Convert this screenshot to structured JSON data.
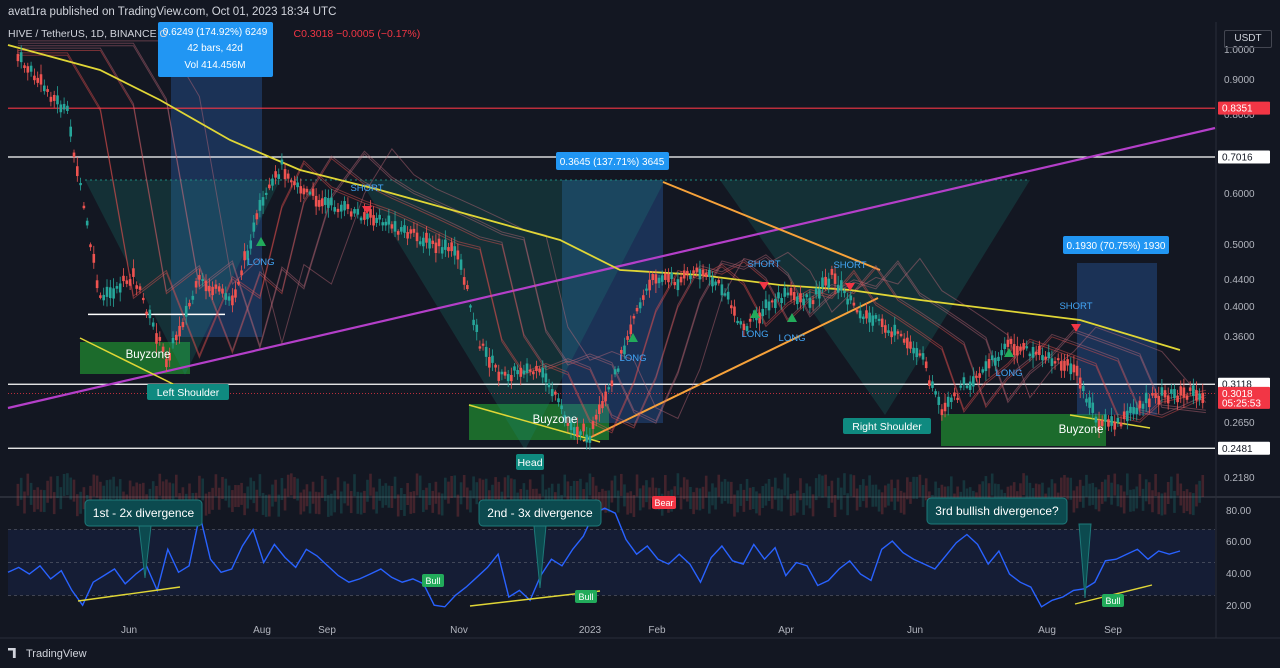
{
  "header": {
    "published_text": "avat1ra published on TradingView.com, Oct 01, 2023 18:34 UTC",
    "symbol_line": "HIVE / TetherUS, 1D, BINANCE",
    "ohlc_partial": "O",
    "last_close": "C0.3018",
    "change": "−0.0005 (−0.17%)",
    "currency_button": "USDT"
  },
  "footer": {
    "brand": "TradingView"
  },
  "colors": {
    "background": "#131722",
    "bull_candle": "#26a69a",
    "bear_candle": "#ef5350",
    "ma_yellow": "#e0d636",
    "trend_purple": "#b43fc9",
    "trend_orange": "#f7a23a",
    "rsi_line": "#2962ff",
    "red_level": "#f23645",
    "buyzone": "#1f7a2e",
    "measure_blue": "#2a63b6",
    "pattern_teal": "#1d8c80",
    "label_teal": "#0f8a80",
    "bull_label": "#22ab5b",
    "bear_label": "#f23645"
  },
  "chart_data": [
    {
      "type": "line",
      "name": "HIVE/USDT 1D price",
      "x_tick_labels": [
        "Jun",
        "Aug",
        "Sep",
        "Nov",
        "2023",
        "Feb",
        "Apr",
        "Jun",
        "Aug",
        "Sep"
      ],
      "y_scale": "log",
      "y_tick_labels": [
        "1.0000",
        "0.9000",
        "0.8000",
        "0.6000",
        "0.5000",
        "0.4400",
        "0.4000",
        "0.3600",
        "0.2650",
        "0.2480",
        "0.2180"
      ],
      "ylim": [
        0.21,
        1.05
      ],
      "price_tags": [
        {
          "label": "0.8351",
          "value": 0.8351,
          "color": "#f23645"
        },
        {
          "label": "0.7016",
          "value": 0.7016,
          "color": "#ffffff"
        },
        {
          "label": "0.3118",
          "value": 0.3118,
          "color": "#ffffff"
        },
        {
          "label": "0.3018",
          "value": 0.3018,
          "color": "#f23645",
          "sub": "05:25:53"
        },
        {
          "label": "0.2481",
          "value": 0.2481,
          "color": "#ffffff"
        }
      ],
      "approx_close_path": [
        [
          "Apr 2022",
          1.0
        ],
        [
          "May 2022",
          0.82
        ],
        [
          "May 2022",
          0.42
        ],
        [
          "Jun 2022",
          0.46
        ],
        [
          "Jun 2022",
          0.34
        ],
        [
          "Jul 2022",
          0.45
        ],
        [
          "Jul 2022",
          0.42
        ],
        [
          "Aug 2022",
          0.58
        ],
        [
          "Aug 2022",
          0.68
        ],
        [
          "Aug 2022",
          0.62
        ],
        [
          "Sep 2022",
          0.59
        ],
        [
          "Sep 2022",
          0.57
        ],
        [
          "Oct 2022",
          0.55
        ],
        [
          "Oct 2022",
          0.53
        ],
        [
          "Oct 2022",
          0.51
        ],
        [
          "Nov 2022",
          0.5
        ],
        [
          "Nov 2022",
          0.36
        ],
        [
          "Nov 2022",
          0.32
        ],
        [
          "Dec 2022",
          0.33
        ],
        [
          "Dec 2022",
          0.32
        ],
        [
          "Dec 2022",
          0.27
        ],
        [
          "Jan 2023",
          0.26
        ],
        [
          "Jan 2023",
          0.31
        ],
        [
          "Jan 2023",
          0.4
        ],
        [
          "Feb 2023",
          0.46
        ],
        [
          "Feb 2023",
          0.45
        ],
        [
          "Feb 2023",
          0.47
        ],
        [
          "Mar 2023",
          0.44
        ],
        [
          "Mar 2023",
          0.38
        ],
        [
          "Mar 2023",
          0.41
        ],
        [
          "Apr 2023",
          0.43
        ],
        [
          "Apr 2023",
          0.42
        ],
        [
          "Apr 2023",
          0.46
        ],
        [
          "May 2023",
          0.41
        ],
        [
          "May 2023",
          0.39
        ],
        [
          "May 2023",
          0.37
        ],
        [
          "Jun 2023",
          0.35
        ],
        [
          "Jun 2023",
          0.28
        ],
        [
          "Jun 2023",
          0.31
        ],
        [
          "Jul 2023",
          0.33
        ],
        [
          "Jul 2023",
          0.36
        ],
        [
          "Jul 2023",
          0.35
        ],
        [
          "Aug 2023",
          0.34
        ],
        [
          "Aug 2023",
          0.33
        ],
        [
          "Aug 2023",
          0.275
        ],
        [
          "Sep 2023",
          0.27
        ],
        [
          "Sep 2023",
          0.29
        ],
        [
          "Sep 2023",
          0.3
        ],
        [
          "Oct 2023",
          0.3018
        ]
      ],
      "annotations": [
        {
          "text": "0.6249 (174.92%) 6249",
          "sub": "42 bars, 42d",
          "sub2": "Vol 414.456M"
        },
        {
          "text": "0.3645 (137.71%) 3645"
        },
        {
          "text": "0.1930 (70.75%) 1930"
        },
        {
          "text": "Buyzone"
        },
        {
          "text": "Buyzone"
        },
        {
          "text": "Buyzone"
        },
        {
          "text": "Left Shoulder"
        },
        {
          "text": "Head"
        },
        {
          "text": "Right Shoulder"
        },
        {
          "text": "SHORT"
        },
        {
          "text": "SHORT"
        },
        {
          "text": "SHORT"
        },
        {
          "text": "SHORT"
        },
        {
          "text": "LONG"
        },
        {
          "text": "LONG"
        },
        {
          "text": "LONG"
        },
        {
          "text": "LONG"
        },
        {
          "text": "LONG"
        }
      ]
    },
    {
      "type": "line",
      "name": "RSI",
      "y_tick_labels": [
        "80.00",
        "60.00",
        "40.00",
        "20.00"
      ],
      "ylim": [
        15,
        88
      ],
      "approx_values": [
        44,
        47,
        43,
        48,
        40,
        45,
        33,
        24,
        38,
        42,
        46,
        37,
        43,
        48,
        33,
        58,
        44,
        48,
        79,
        52,
        44,
        46,
        60,
        70,
        50,
        61,
        53,
        47,
        58,
        54,
        48,
        42,
        38,
        40,
        43,
        46,
        41,
        38,
        40,
        37,
        24,
        23,
        30,
        35,
        41,
        47,
        55,
        29,
        33,
        27,
        42,
        52,
        48,
        58,
        66,
        80,
        83,
        80,
        64,
        55,
        60,
        52,
        49,
        55,
        49,
        38,
        53,
        60,
        51,
        49,
        61,
        52,
        59,
        42,
        50,
        48,
        36,
        39,
        46,
        51,
        43,
        39,
        58,
        63,
        56,
        52,
        49,
        46,
        54,
        62,
        67,
        61,
        49,
        57,
        43,
        38,
        35,
        23,
        27,
        29,
        33,
        34,
        38,
        51,
        52,
        55,
        58,
        52,
        57,
        55,
        57
      ],
      "callouts": [
        {
          "text": "1st - 2x divergence"
        },
        {
          "text": "2nd - 3x divergence"
        },
        {
          "text": "3rd bullish divergence?"
        }
      ],
      "labels": [
        {
          "text": "Bull"
        },
        {
          "text": "Bull"
        },
        {
          "text": "Bull"
        },
        {
          "text": "Bear"
        }
      ]
    }
  ]
}
